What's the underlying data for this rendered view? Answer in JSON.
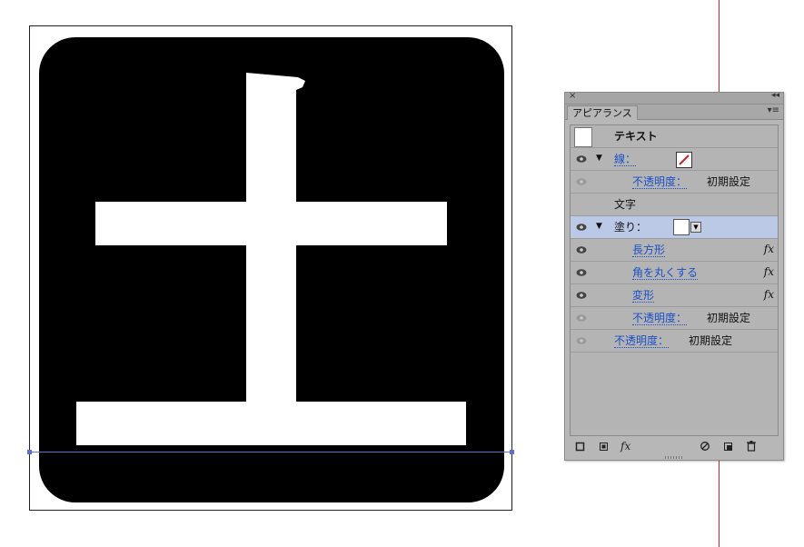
{
  "panel": {
    "tab_label": "アピアランス",
    "close_glyph": "×",
    "collapse_glyph": "◂◂",
    "menu_glyph": "▾≡",
    "rows": {
      "object": {
        "label": "テキスト"
      },
      "stroke": {
        "label": "線：",
        "swatch": "none-stroke"
      },
      "stroke_opacity": {
        "label": "不透明度：",
        "value": "初期設定"
      },
      "characters": {
        "label": "文字"
      },
      "fill": {
        "label": "塗り：",
        "swatch_color": "#ffffff"
      },
      "effect_rectangle": {
        "label": "長方形",
        "fx": "fx"
      },
      "effect_round_corners": {
        "label": "角を丸くする",
        "fx": "fx"
      },
      "effect_transform": {
        "label": "変形",
        "fx": "fx"
      },
      "fill_opacity": {
        "label": "不透明度：",
        "value": "初期設定"
      },
      "object_opacity": {
        "label": "不透明度：",
        "value": "初期設定"
      }
    },
    "bottom_icons": [
      "add-new-stroke-icon",
      "add-new-fill-icon",
      "add-new-effect-icon",
      "clear-appearance-icon",
      "duplicate-item-icon",
      "delete-item-icon"
    ],
    "fx_menu_label": "fx"
  },
  "artwork": {
    "glyph_character": "土",
    "background": "#000000",
    "glyph_color": "#ffffff"
  },
  "colors": {
    "guide_red": "#c0252a",
    "guide_blue": "#5b6fd6",
    "selection_row": "#bcc9e6",
    "link_blue": "#1a4fc9"
  }
}
